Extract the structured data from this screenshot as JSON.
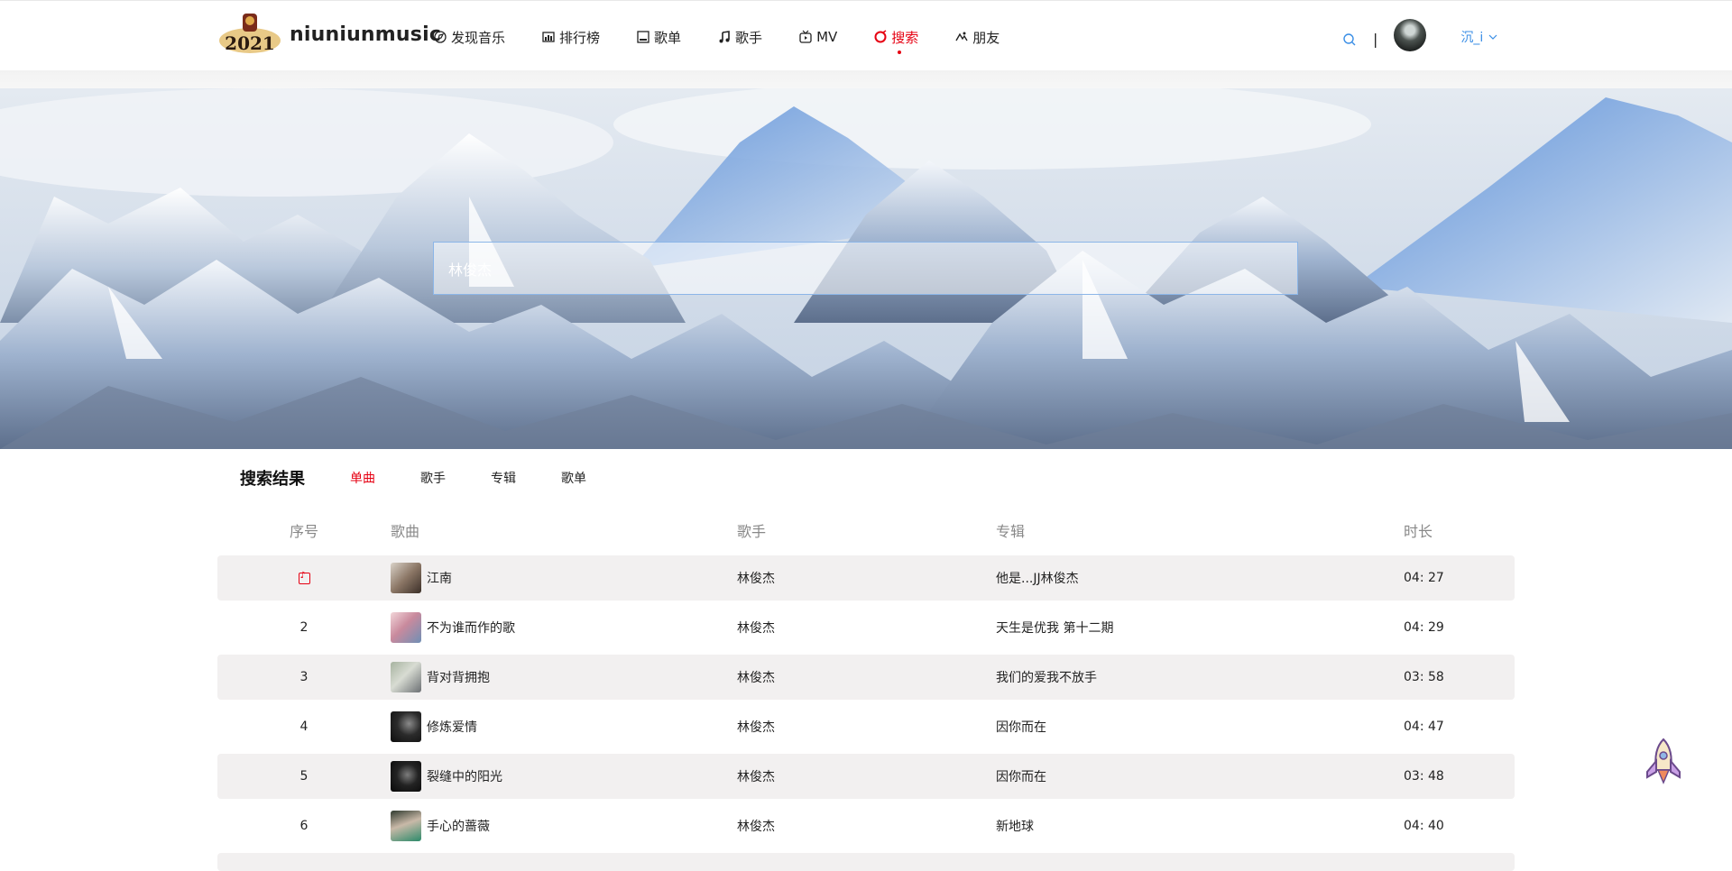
{
  "header": {
    "brand": "niuniunmusic",
    "logo_year": "2021",
    "nav": [
      {
        "label": "发现音乐",
        "icon": "discover-icon"
      },
      {
        "label": "排行榜",
        "icon": "chart-icon"
      },
      {
        "label": "歌单",
        "icon": "playlist-icon"
      },
      {
        "label": "歌手",
        "icon": "music-note-icon"
      },
      {
        "label": "MV",
        "icon": "tv-icon"
      },
      {
        "label": "搜索",
        "icon": "search-circle-icon",
        "active": true
      },
      {
        "label": "朋友",
        "icon": "friends-icon"
      }
    ],
    "separator": "|",
    "username": "沉_i",
    "accent": "#e60012",
    "link_color": "#3a8ee6"
  },
  "search": {
    "value": "林俊杰"
  },
  "results": {
    "title": "搜索结果",
    "tabs": [
      "单曲",
      "歌手",
      "专辑",
      "歌单"
    ],
    "active_tab": "单曲",
    "columns": {
      "index": "序号",
      "song": "歌曲",
      "artist": "歌手",
      "album": "专辑",
      "duration": "时长"
    },
    "rows": [
      {
        "index": "",
        "playing": true,
        "song": "江南",
        "artist": "林俊杰",
        "album": "他是...JJ林俊杰",
        "duration": "04: 27"
      },
      {
        "index": "2",
        "song": "不为谁而作的歌",
        "artist": "林俊杰",
        "album": "天生是优我 第十二期",
        "duration": "04: 29"
      },
      {
        "index": "3",
        "song": "背对背拥抱",
        "artist": "林俊杰",
        "album": "我们的爱我不放手",
        "duration": "03: 58"
      },
      {
        "index": "4",
        "song": "修炼爱情",
        "artist": "林俊杰",
        "album": "因你而在",
        "duration": "04: 47"
      },
      {
        "index": "5",
        "song": "裂缝中的阳光",
        "artist": "林俊杰",
        "album": "因你而在",
        "duration": "03: 48"
      },
      {
        "index": "6",
        "song": "手心的蔷薇",
        "artist": "林俊杰",
        "album": "新地球",
        "duration": "04: 40"
      }
    ]
  }
}
